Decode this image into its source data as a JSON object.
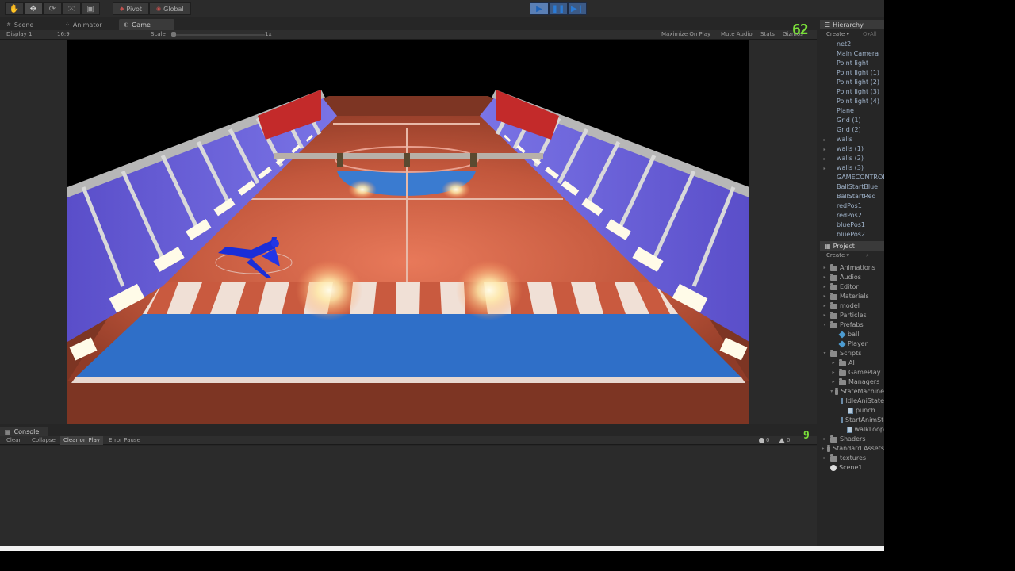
{
  "toolbar": {
    "tools": [
      "hand-icon",
      "move-icon",
      "rotate-icon",
      "scale-icon",
      "rect-icon"
    ],
    "pivot_label": "Pivot",
    "global_label": "Global",
    "play_controls": [
      "play-icon",
      "pause-icon",
      "step-icon"
    ]
  },
  "tabs": [
    {
      "label": "Scene",
      "icon": "scene-icon"
    },
    {
      "label": "Animator",
      "icon": "animator-icon"
    },
    {
      "label": "Game",
      "icon": "game-icon"
    }
  ],
  "game_bar": {
    "display": "Display 1",
    "aspect": "16:9",
    "scale_label": "Scale",
    "scale_value": "1x",
    "maximize": "Maximize On Play",
    "mute": "Mute Audio",
    "stats": "Stats",
    "gizmos": "Gizmos"
  },
  "fps_counter": "62",
  "hierarchy": {
    "title": "Hierarchy",
    "create": "Create ▾",
    "search_placeholder": "Q▾All",
    "items": [
      {
        "label": "net2",
        "expandable": false
      },
      {
        "label": "Main Camera",
        "expandable": false
      },
      {
        "label": "Point light",
        "expandable": false
      },
      {
        "label": "Point light (1)",
        "expandable": false
      },
      {
        "label": "Point light (2)",
        "expandable": false
      },
      {
        "label": "Point light (3)",
        "expandable": false
      },
      {
        "label": "Point light (4)",
        "expandable": false
      },
      {
        "label": "Plane",
        "expandable": false
      },
      {
        "label": "Grid (1)",
        "expandable": false
      },
      {
        "label": "Grid (2)",
        "expandable": false
      },
      {
        "label": "walls",
        "expandable": true
      },
      {
        "label": "walls (1)",
        "expandable": true
      },
      {
        "label": "walls (2)",
        "expandable": true
      },
      {
        "label": "walls (3)",
        "expandable": true
      },
      {
        "label": "GAMECONTROLLER",
        "expandable": false
      },
      {
        "label": "BallStartBlue",
        "expandable": false
      },
      {
        "label": "BallStartRed",
        "expandable": false
      },
      {
        "label": "redPos1",
        "expandable": false
      },
      {
        "label": "redPos2",
        "expandable": false
      },
      {
        "label": "bluePos1",
        "expandable": false
      },
      {
        "label": "bluePos2",
        "expandable": false
      }
    ]
  },
  "project": {
    "title": "Project",
    "create": "Create ▾",
    "items": [
      {
        "label": "Animations",
        "type": "folder",
        "depth": 0,
        "expanded": false
      },
      {
        "label": "Audios",
        "type": "folder",
        "depth": 0,
        "expanded": false
      },
      {
        "label": "Editor",
        "type": "folder",
        "depth": 0,
        "expanded": false
      },
      {
        "label": "Materials",
        "type": "folder",
        "depth": 0,
        "expanded": false
      },
      {
        "label": "model",
        "type": "folder",
        "depth": 0,
        "expanded": false
      },
      {
        "label": "Particles",
        "type": "folder",
        "depth": 0,
        "expanded": false
      },
      {
        "label": "Prefabs",
        "type": "folder",
        "depth": 0,
        "expanded": true
      },
      {
        "label": "ball",
        "type": "prefab",
        "depth": 1,
        "expanded": false
      },
      {
        "label": "Player",
        "type": "prefab",
        "depth": 1,
        "expanded": false
      },
      {
        "label": "Scripts",
        "type": "folder",
        "depth": 0,
        "expanded": true
      },
      {
        "label": "AI",
        "type": "folder",
        "depth": 1,
        "expanded": false
      },
      {
        "label": "GamePlay",
        "type": "folder",
        "depth": 1,
        "expanded": false
      },
      {
        "label": "Managers",
        "type": "folder",
        "depth": 1,
        "expanded": false
      },
      {
        "label": "StateMachine",
        "type": "folder",
        "depth": 1,
        "expanded": true
      },
      {
        "label": "IdleAniState",
        "type": "script",
        "depth": 2,
        "expanded": false
      },
      {
        "label": "punch",
        "type": "script",
        "depth": 2,
        "expanded": false
      },
      {
        "label": "StartAnimState",
        "type": "script",
        "depth": 2,
        "expanded": false
      },
      {
        "label": "walkLoop",
        "type": "script",
        "depth": 2,
        "expanded": false
      },
      {
        "label": "Shaders",
        "type": "folder",
        "depth": 0,
        "expanded": false
      },
      {
        "label": "Standard Assets",
        "type": "folder",
        "depth": 0,
        "expanded": false
      },
      {
        "label": "textures",
        "type": "folder",
        "depth": 0,
        "expanded": false
      },
      {
        "label": "Scene1",
        "type": "scene",
        "depth": 0,
        "expanded": false
      }
    ]
  },
  "console": {
    "title": "Console",
    "buttons": [
      {
        "label": "Clear",
        "active": false
      },
      {
        "label": "Collapse",
        "active": false
      },
      {
        "label": "Clear on Play",
        "active": true
      },
      {
        "label": "Error Pause",
        "active": false
      }
    ],
    "info_count": "0",
    "warn_count": "0",
    "error_count": "0",
    "mini_counter": "9"
  },
  "colors": {
    "court_red": "#b8563b",
    "court_blue": "#2f6fc8",
    "player_blue": "#1a2ed8",
    "fps_green": "#7be03a"
  }
}
